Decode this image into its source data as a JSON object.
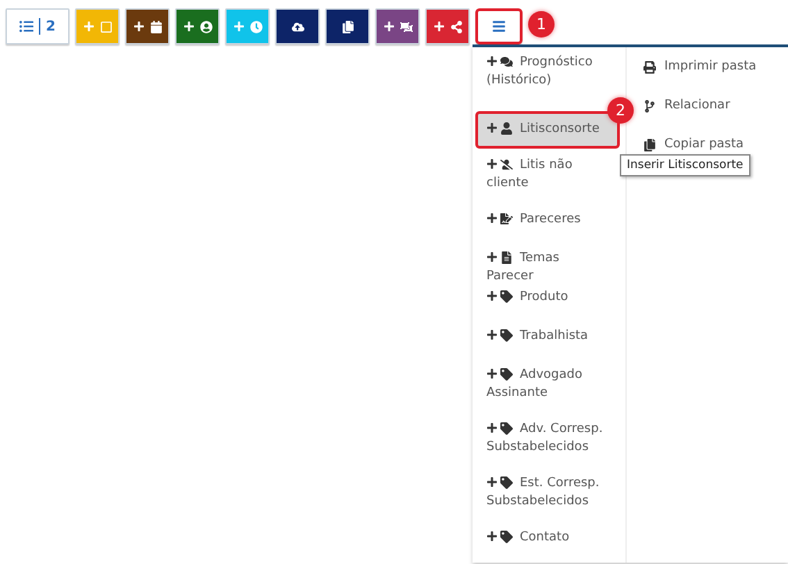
{
  "toolbar": {
    "buttons": [
      {
        "kind": "counter",
        "color": "#ffffff",
        "count": "2",
        "selected": false
      },
      {
        "kind": "icon",
        "color": "#f2b705",
        "selected": false
      },
      {
        "kind": "icon",
        "color": "#6b3a0e",
        "selected": false
      },
      {
        "kind": "icon",
        "color": "#1a6e1f",
        "selected": false
      },
      {
        "kind": "icon",
        "color": "#10c3ea",
        "selected": false
      },
      {
        "kind": "icon",
        "color": "#0d2468",
        "selected": false
      },
      {
        "kind": "icon",
        "color": "#0d2468",
        "selected": false
      },
      {
        "kind": "icon",
        "color": "#7a4585",
        "selected": false
      },
      {
        "kind": "icon",
        "color": "#d92633",
        "selected": false
      },
      {
        "kind": "menu",
        "color": "#ffffff",
        "selected": true
      }
    ],
    "callout": "1"
  },
  "menu": {
    "left_items": [
      {
        "label": "Prognóstico (Histórico)",
        "selected": false
      },
      {
        "label": "Litisconsorte",
        "selected": true,
        "callout": "2"
      },
      {
        "label": "Litis não cliente",
        "selected": false
      },
      {
        "label": "Pareceres",
        "selected": false
      },
      {
        "label": "Temas Parecer",
        "selected": false
      },
      {
        "label": "Produto",
        "selected": false
      },
      {
        "label": "Trabalhista",
        "selected": false
      },
      {
        "label": "Advogado Assinante",
        "selected": false
      },
      {
        "label": "Adv. Corresp. Substabelecidos",
        "selected": false
      },
      {
        "label": "Est. Corresp. Substabelecidos",
        "selected": false
      },
      {
        "label": "Contato",
        "selected": false
      }
    ],
    "right_items": [
      {
        "label": "Imprimir pasta"
      },
      {
        "label": "Relacionar"
      },
      {
        "label": "Copiar pasta"
      }
    ],
    "tooltip": "Inserir Litisconsorte"
  }
}
